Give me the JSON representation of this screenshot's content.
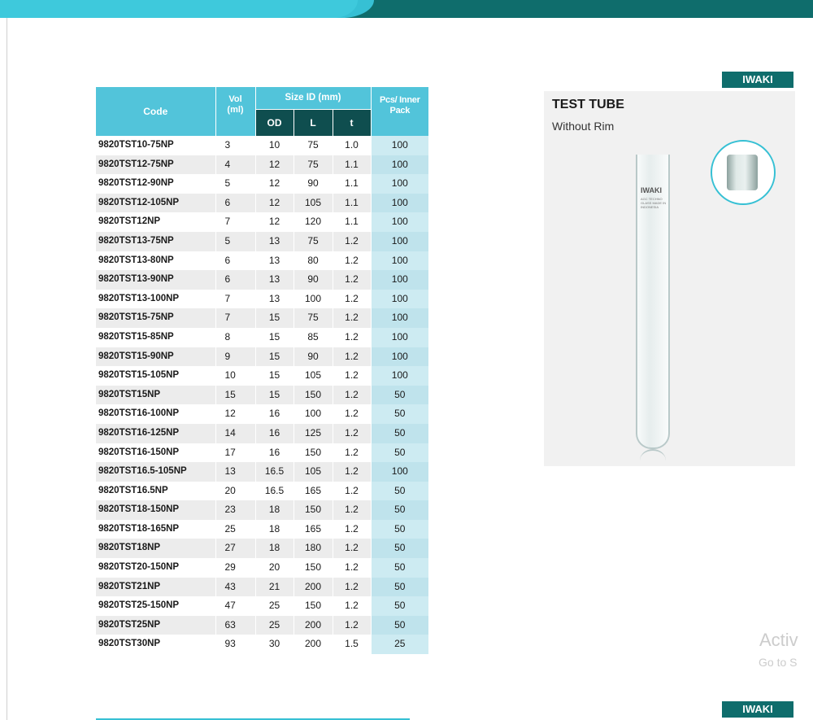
{
  "brand": "IWAKI",
  "product": {
    "title": "TEST TUBE",
    "subtitle": "Without Rim",
    "tube_print": "IWAKI",
    "tube_print_small": "AGC TECHNO GLASS MADE IN INDONESIA"
  },
  "table": {
    "headers": {
      "code": "Code",
      "vol": "Vol (ml)",
      "size": "Size ID (mm)",
      "od": "OD",
      "l": "L",
      "t": "t",
      "pcs": "Pcs/ Inner Pack"
    },
    "rows": [
      {
        "code": "9820TST10-75NP",
        "vol": "3",
        "od": "10",
        "l": "75",
        "t": "1.0",
        "pcs": "100"
      },
      {
        "code": "9820TST12-75NP",
        "vol": "4",
        "od": "12",
        "l": "75",
        "t": "1.1",
        "pcs": "100"
      },
      {
        "code": "9820TST12-90NP",
        "vol": "5",
        "od": "12",
        "l": "90",
        "t": "1.1",
        "pcs": "100"
      },
      {
        "code": "9820TST12-105NP",
        "vol": "6",
        "od": "12",
        "l": "105",
        "t": "1.1",
        "pcs": "100"
      },
      {
        "code": "9820TST12NP",
        "vol": "7",
        "od": "12",
        "l": "120",
        "t": "1.1",
        "pcs": "100"
      },
      {
        "code": "9820TST13-75NP",
        "vol": "5",
        "od": "13",
        "l": "75",
        "t": "1.2",
        "pcs": "100"
      },
      {
        "code": "9820TST13-80NP",
        "vol": "6",
        "od": "13",
        "l": "80",
        "t": "1.2",
        "pcs": "100"
      },
      {
        "code": "9820TST13-90NP",
        "vol": "6",
        "od": "13",
        "l": "90",
        "t": "1.2",
        "pcs": "100"
      },
      {
        "code": "9820TST13-100NP",
        "vol": "7",
        "od": "13",
        "l": "100",
        "t": "1.2",
        "pcs": "100"
      },
      {
        "code": "9820TST15-75NP",
        "vol": "7",
        "od": "15",
        "l": "75",
        "t": "1.2",
        "pcs": "100"
      },
      {
        "code": "9820TST15-85NP",
        "vol": "8",
        "od": "15",
        "l": "85",
        "t": "1.2",
        "pcs": "100"
      },
      {
        "code": "9820TST15-90NP",
        "vol": "9",
        "od": "15",
        "l": "90",
        "t": "1.2",
        "pcs": "100"
      },
      {
        "code": "9820TST15-105NP",
        "vol": "10",
        "od": "15",
        "l": "105",
        "t": "1.2",
        "pcs": "100"
      },
      {
        "code": "9820TST15NP",
        "vol": "15",
        "od": "15",
        "l": "150",
        "t": "1.2",
        "pcs": "50"
      },
      {
        "code": "9820TST16-100NP",
        "vol": "12",
        "od": "16",
        "l": "100",
        "t": "1.2",
        "pcs": "50"
      },
      {
        "code": "9820TST16-125NP",
        "vol": "14",
        "od": "16",
        "l": "125",
        "t": "1.2",
        "pcs": "50"
      },
      {
        "code": "9820TST16-150NP",
        "vol": "17",
        "od": "16",
        "l": "150",
        "t": "1.2",
        "pcs": "50"
      },
      {
        "code": "9820TST16.5-105NP",
        "vol": "13",
        "od": "16.5",
        "l": "105",
        "t": "1.2",
        "pcs": "100"
      },
      {
        "code": "9820TST16.5NP",
        "vol": "20",
        "od": "16.5",
        "l": "165",
        "t": "1.2",
        "pcs": "50"
      },
      {
        "code": "9820TST18-150NP",
        "vol": "23",
        "od": "18",
        "l": "150",
        "t": "1.2",
        "pcs": "50"
      },
      {
        "code": "9820TST18-165NP",
        "vol": "25",
        "od": "18",
        "l": "165",
        "t": "1.2",
        "pcs": "50"
      },
      {
        "code": "9820TST18NP",
        "vol": "27",
        "od": "18",
        "l": "180",
        "t": "1.2",
        "pcs": "50"
      },
      {
        "code": "9820TST20-150NP",
        "vol": "29",
        "od": "20",
        "l": "150",
        "t": "1.2",
        "pcs": "50"
      },
      {
        "code": "9820TST21NP",
        "vol": "43",
        "od": "21",
        "l": "200",
        "t": "1.2",
        "pcs": "50"
      },
      {
        "code": "9820TST25-150NP",
        "vol": "47",
        "od": "25",
        "l": "150",
        "t": "1.2",
        "pcs": "50"
      },
      {
        "code": "9820TST25NP",
        "vol": "63",
        "od": "25",
        "l": "200",
        "t": "1.2",
        "pcs": "50"
      },
      {
        "code": "9820TST30NP",
        "vol": "93",
        "od": "30",
        "l": "200",
        "t": "1.5",
        "pcs": "25"
      }
    ]
  },
  "watermark": {
    "line1": "Activ",
    "line2": "Go to S"
  },
  "colors": {
    "header_dark": "#0f6d6c",
    "header_light": "#36c0d4",
    "table_header": "#52c4da",
    "table_subheader": "#0f4e4f",
    "row_tint": "#cdebf2"
  }
}
